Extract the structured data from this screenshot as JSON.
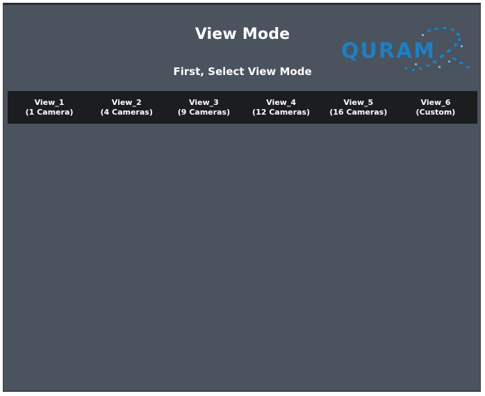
{
  "header": {
    "title": "View Mode",
    "subtitle": "First, Select View Mode",
    "logo_text": "QURAM"
  },
  "views": [
    {
      "name": "View_1",
      "desc": "(1 Camera)"
    },
    {
      "name": "View_2",
      "desc": "(4 Cameras)"
    },
    {
      "name": "View_3",
      "desc": "(9 Cameras)"
    },
    {
      "name": "View_4",
      "desc": "(12 Cameras)"
    },
    {
      "name": "View_5",
      "desc": "(16 Cameras)"
    },
    {
      "name": "View_6",
      "desc": "(Custom)"
    }
  ],
  "colors": {
    "background": "#4a535e",
    "bar": "#1c1d1f",
    "logo_blue": "#1e7fc4",
    "logo_light": "#6fb5e6"
  }
}
